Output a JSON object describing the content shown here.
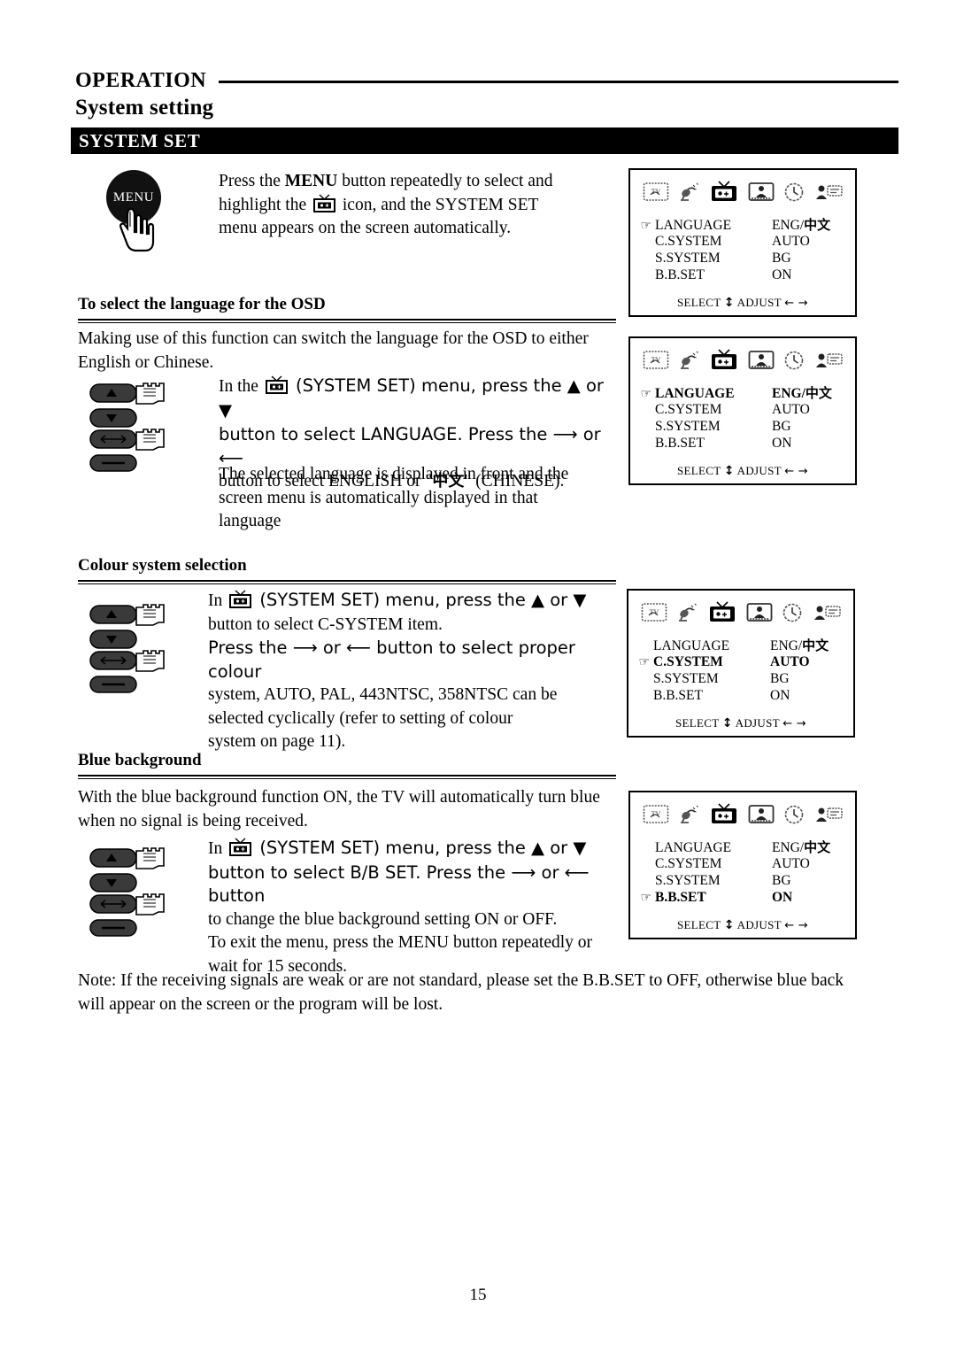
{
  "header": {
    "operation": "OPERATION",
    "subtitle": "System setting",
    "banner": "SYSTEM SET"
  },
  "intro": {
    "menu_button_label": "MENU",
    "line1_a": "Press the ",
    "line1_b": "MENU",
    "line1_c": " button repeatedly to select and",
    "line2_a": "highlight the ",
    "line2_b": " icon, and the SYSTEM SET",
    "line3": "menu appears on the screen automatically."
  },
  "sections": [
    {
      "heading": "To select the language for the OSD",
      "lead": "Making use of this function can switch the language for the OSD to either English or Chinese.",
      "steps_line1_pre": "In the ",
      "steps_line1_post": " (SYSTEM SET) menu, press the ▲ or ▼",
      "steps_line2": "button to select LANGUAGE. Press the ⟶ or ⟵",
      "steps_line3_pre": "button to select ENGLISH or \"",
      "steps_line3_cn": "中文",
      "steps_line3_post": "\" (CHINESE).",
      "extra": "The selected language is displayed in front and the screen menu is automatically displayed in that language"
    },
    {
      "heading": "Colour system selection",
      "steps_line1_pre": "In ",
      "steps_line1_post": " (SYSTEM SET) menu, press the ▲ or ▼",
      "steps_line2": "button to select C-SYSTEM item.",
      "steps_line3": "Press the ⟶ or ⟵ button to select proper colour",
      "steps_line4": "system, AUTO, PAL, 443NTSC, 358NTSC can be",
      "steps_line5": "selected cyclically (refer to setting of colour",
      "steps_line6": "system on page 11)."
    },
    {
      "heading": "Blue background",
      "lead": "With the blue background function ON, the TV will automatically turn blue when no signal is being received.",
      "steps_line1_pre": "In ",
      "steps_line1_post": " (SYSTEM SET) menu, press the ▲ or ▼",
      "steps_line2": "button to select B/B SET. Press the ⟶ or ⟵ button",
      "steps_line3": "to change the blue background setting ON or OFF.",
      "steps_line4": "To exit the menu, press the MENU button repeatedly or",
      "steps_line5": "wait for 15 seconds."
    }
  ],
  "note": "Note: If the receiving signals are weak or are not standard, please set the B.B.SET to OFF, otherwise blue back will appear on the screen or the program will be lost.",
  "osd": {
    "icons": [
      "picture-tv-icon",
      "satellite-dish-icon",
      "system-set-tv-icon",
      "person-screen-icon",
      "clock-icon",
      "caption-person-icon"
    ],
    "pointer_glyph": "☞",
    "footer_select": "SELECT",
    "footer_select_arrows": "↕",
    "footer_adjust": "ADJUST",
    "footer_adjust_arrows": "← →",
    "labels": {
      "language": "LANGUAGE",
      "csystem": "C.SYSTEM",
      "ssystem": "S.SYSTEM",
      "bbset": "B.B.SET"
    },
    "values": {
      "language_en": "ENG/",
      "language_cn": "中文",
      "csystem": "AUTO",
      "ssystem": "BG",
      "bbset": "ON"
    },
    "panels": [
      {
        "selected": "language",
        "bold_row": false
      },
      {
        "selected": "language",
        "bold_row": true
      },
      {
        "selected": "csystem",
        "bold_row": true
      },
      {
        "selected": "bbset",
        "bold_row": true
      }
    ]
  },
  "page_number": "15",
  "colors": {
    "ink": "#000000",
    "paper": "#ffffff",
    "banner_bg": "#000000",
    "banner_fg": "#ffffff"
  }
}
